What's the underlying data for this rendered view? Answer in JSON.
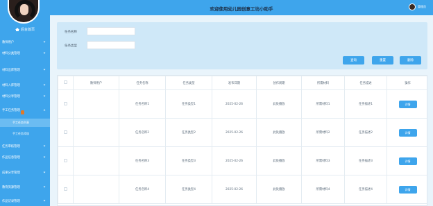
{
  "header": {
    "title": "欢迎使用幼儿园创意工坊小助手",
    "user_name": "管理员"
  },
  "sidebar": {
    "home_label": "后台首页",
    "items": [
      {
        "label": "教师用户",
        "open": false
      },
      {
        "label": "材料分类管理",
        "open": false
      },
      {
        "label": "材料出库管理",
        "open": false
      },
      {
        "label": "材料入库管理",
        "open": false
      },
      {
        "label": "材料分享管理",
        "open": false
      },
      {
        "label": "手工任务管理",
        "open": true
      },
      {
        "label": "任务审核管理",
        "open": false
      },
      {
        "label": "作品信息管理",
        "open": false
      },
      {
        "label": "成果分享管理",
        "open": false
      },
      {
        "label": "教育资源管理",
        "open": false
      },
      {
        "label": "作品记录管理",
        "open": false
      }
    ],
    "sub_items": [
      {
        "label": "手工任务列表",
        "active": true
      },
      {
        "label": "手工任务添加",
        "active": false
      }
    ]
  },
  "search": {
    "name_label": "任务名称",
    "type_label": "任务类型",
    "name_value": "",
    "type_value": "",
    "query_button": "查询",
    "reset_button": "重置",
    "delete_button": "删除"
  },
  "table": {
    "columns": [
      "教师用户",
      "任务名称",
      "任务类型",
      "发布日期",
      "创作周期",
      "所需材料",
      "任务描述",
      "操作"
    ],
    "rows": [
      {
        "teacher": "",
        "name": "任务名称1",
        "type": "任务类型1",
        "date": "2025-02-26",
        "cycle": "此处播放",
        "materials": "所需材料1",
        "desc": "任务描述1",
        "action": "详情"
      },
      {
        "teacher": "",
        "name": "任务名称2",
        "type": "任务类型2",
        "date": "2025-02-26",
        "cycle": "此处播放",
        "materials": "所需材料2",
        "desc": "任务描述2",
        "action": "详情"
      },
      {
        "teacher": "",
        "name": "任务名称3",
        "type": "任务类型3",
        "date": "2025-02-26",
        "cycle": "此处播放",
        "materials": "所需材料3",
        "desc": "任务描述3",
        "action": "详情"
      },
      {
        "teacher": "",
        "name": "任务名称4",
        "type": "任务类型4",
        "date": "2025-02-26",
        "cycle": "此处播放",
        "materials": "所需材料4",
        "desc": "任务描述4",
        "action": "详情"
      }
    ]
  }
}
